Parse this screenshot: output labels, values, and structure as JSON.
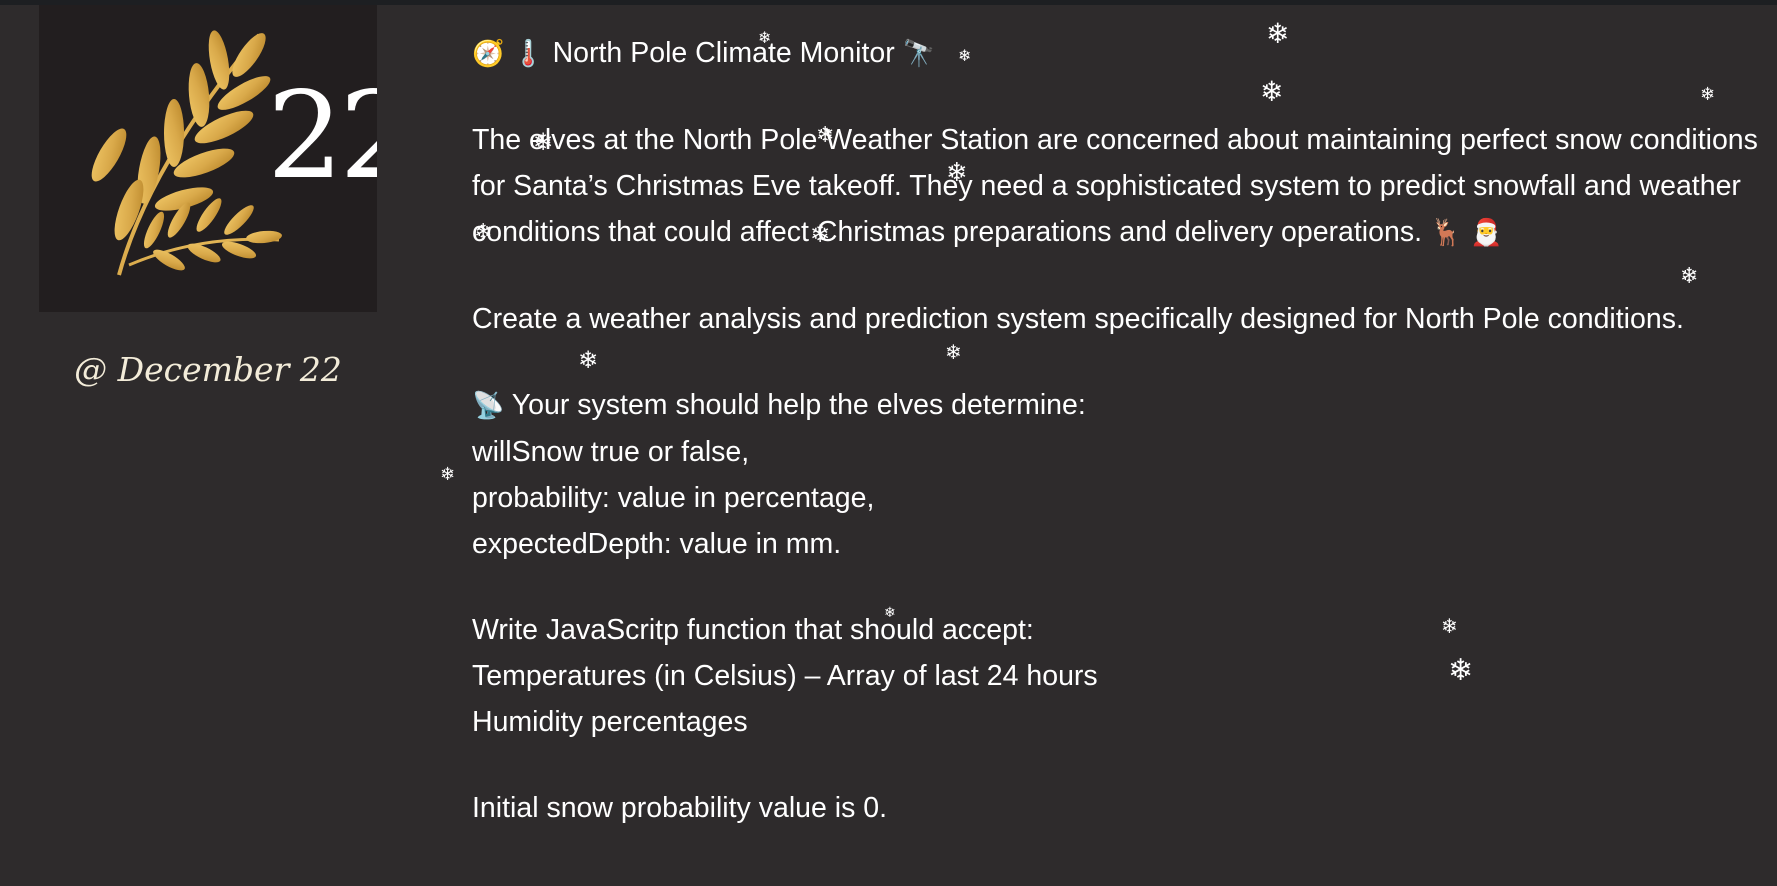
{
  "card": {
    "day": "22",
    "date": "@ December 22"
  },
  "content": {
    "title_icons_left": [
      "🧭",
      "🌡️"
    ],
    "title": "North Pole Climate Monitor",
    "title_icon_right": "🔭",
    "intro": "The elves at the North Pole Weather Station are concerned about maintaining perfect snow conditions for Santa’s Christmas Eve takeoff. They need a sophisticated system to predict snowfall and weather conditions that could affect Christmas preparations and delivery operations.",
    "intro_icons": [
      "🦌",
      "🎅"
    ],
    "task": "Create a weather analysis and prediction system specifically designed for North Pole conditions.",
    "determine_icon": "📡",
    "determine_heading": "Your system should help the elves determine:",
    "determine_items": [
      "willSnow true or false,",
      "probability: value in percentage,",
      "expectedDepth: value in mm."
    ],
    "accept_heading": "Write JavaScritp function that should accept:",
    "accept_items": [
      "Temperatures (in Celsius) – Array of last 24 hours",
      "Humidity percentages"
    ],
    "initial": "Initial snow probability value is 0."
  },
  "decor": {
    "snowflake_glyph": "❄",
    "snowflake_icon": "snowflake-icon",
    "leaf_colors": [
      "#d9a94a",
      "#b88529",
      "#f0c766"
    ]
  }
}
